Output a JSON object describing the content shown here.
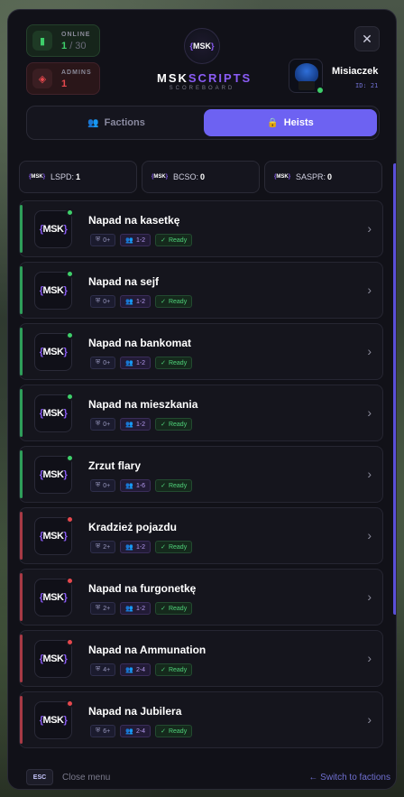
{
  "header": {
    "online_label": "ONLINE",
    "online_count": "1",
    "online_max": "/ 30",
    "admins_label": "ADMINS",
    "admins_count": "1",
    "brand_main": "MSK",
    "brand_accent": "SCRIPTS",
    "brand_sub": "SCOREBOARD",
    "logo_text": "MSK",
    "close_symbol": "✕",
    "user_name": "Misiaczek",
    "user_id": "ID: 21"
  },
  "tabs": [
    {
      "label": "Factions",
      "active": false
    },
    {
      "label": "Heists",
      "active": true
    }
  ],
  "factions": [
    {
      "name": "LSPD:",
      "value": "1"
    },
    {
      "name": "BCSO:",
      "value": "0"
    },
    {
      "name": "SASPR:",
      "value": "0"
    }
  ],
  "heists": [
    {
      "title": "Napad na kasetkę",
      "police": "0+",
      "players": "1-2",
      "status": "Ready",
      "available": true
    },
    {
      "title": "Napad na sejf",
      "police": "0+",
      "players": "1-2",
      "status": "Ready",
      "available": true
    },
    {
      "title": "Napad na bankomat",
      "police": "0+",
      "players": "1-2",
      "status": "Ready",
      "available": true
    },
    {
      "title": "Napad na mieszkania",
      "police": "0+",
      "players": "1-2",
      "status": "Ready",
      "available": true
    },
    {
      "title": "Zrzut flary",
      "police": "0+",
      "players": "1-6",
      "status": "Ready",
      "available": true
    },
    {
      "title": "Kradzież pojazdu",
      "police": "2+",
      "players": "1-2",
      "status": "Ready",
      "available": false
    },
    {
      "title": "Napad na furgonetkę",
      "police": "2+",
      "players": "1-2",
      "status": "Ready",
      "available": false
    },
    {
      "title": "Napad na Ammunation",
      "police": "4+",
      "players": "2-4",
      "status": "Ready",
      "available": false
    },
    {
      "title": "Napad na Jubilera",
      "police": "6+",
      "players": "2-4",
      "status": "Ready",
      "available": false
    }
  ],
  "footer": {
    "esc_key": "ESC",
    "esc_text": "Close menu",
    "switch_text": "← Switch to factions"
  },
  "colors": {
    "accent": "#6d62f2",
    "available": "#3ecf6a",
    "unavailable": "#e5484d"
  }
}
